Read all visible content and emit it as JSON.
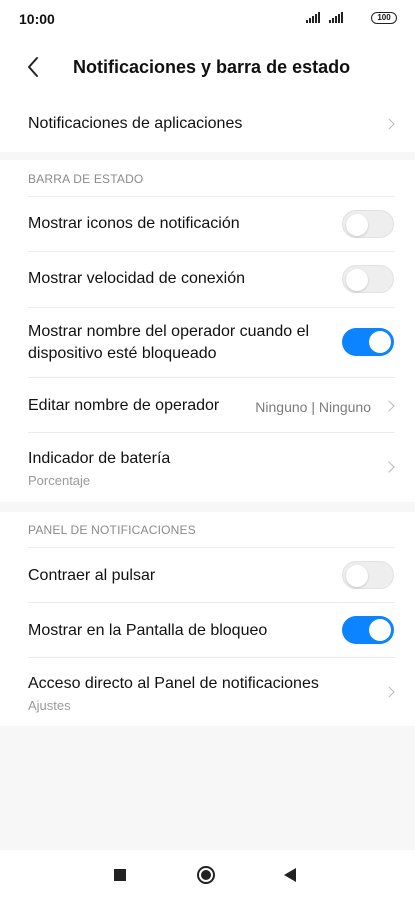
{
  "status_bar": {
    "time": "10:00",
    "battery": "100",
    "icons": [
      "signal-icon",
      "signal-icon",
      "battery-icon"
    ]
  },
  "header": {
    "title": "Notificaciones y barra de estado",
    "back_icon": "chevron-left-icon"
  },
  "top_item": {
    "label": "Notificaciones de aplicaciones"
  },
  "status_bar_section": {
    "title": "BARRA DE ESTADO",
    "items": [
      {
        "label": "Mostrar iconos de notificación",
        "type": "toggle",
        "checked": false
      },
      {
        "label": "Mostrar velocidad de conexión",
        "type": "toggle",
        "checked": false
      },
      {
        "label_line1": "Mostrar nombre del operador cuando el",
        "label_line2": "dispositivo esté bloqueado",
        "type": "toggle",
        "checked": true
      },
      {
        "label": "Editar nombre de operador",
        "value": "Ninguno | Ninguno",
        "type": "link"
      },
      {
        "label": "Indicador de batería",
        "sublabel": "Porcentaje",
        "type": "link"
      }
    ]
  },
  "notification_panel_section": {
    "title": "PANEL DE NOTIFICACIONES",
    "items": [
      {
        "label": "Contraer al pulsar",
        "type": "toggle",
        "checked": false
      },
      {
        "label": "Mostrar en la Pantalla de bloqueo",
        "type": "toggle",
        "checked": true
      },
      {
        "label": "Acceso directo al Panel de notificaciones",
        "sublabel": "Ajustes",
        "type": "link"
      }
    ]
  },
  "colors": {
    "accent": "#0d84ff",
    "background": "#f7f7f7",
    "card": "#ffffff"
  },
  "navbar": {
    "icons": [
      "recents-square-icon",
      "home-circle-icon",
      "back-triangle-icon"
    ]
  }
}
